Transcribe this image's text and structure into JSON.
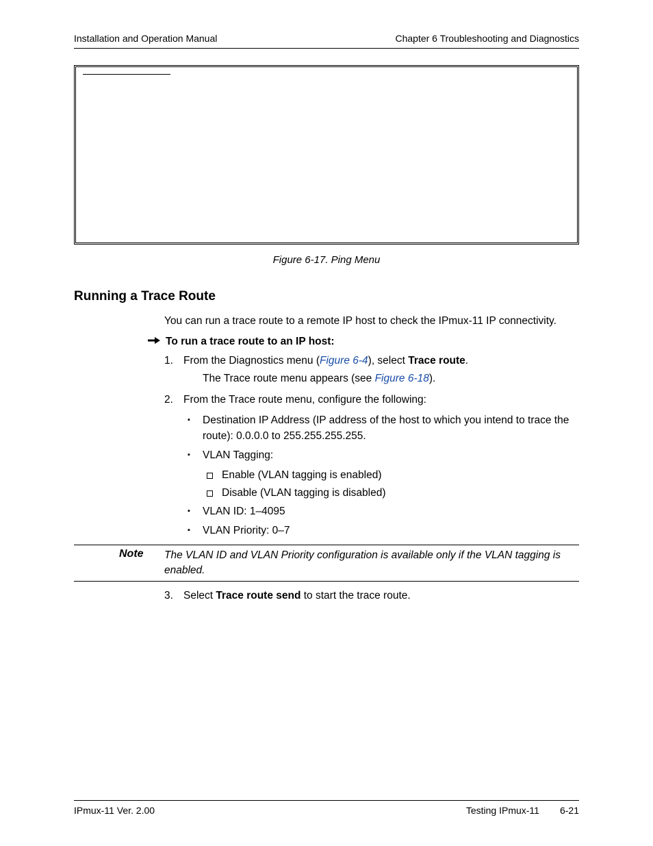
{
  "header": {
    "left": "Installation and Operation Manual",
    "right": "Chapter 6  Troubleshooting and Diagnostics"
  },
  "figcaption": "Figure 6-17.  Ping Menu",
  "section_heading": "Running a Trace Route",
  "intro": "You can run a trace route to a remote IP host to check the IPmux-11 IP connectivity.",
  "proc_heading": "To run a trace route to an IP host:",
  "step1_a": "From the Diagnostics menu (",
  "step1_link": "Figure 6-4",
  "step1_b": "), select ",
  "step1_bold": "Trace route",
  "step1_c": ".",
  "step1_sub_a": "The Trace route menu appears (see ",
  "step1_sub_link": "Figure 6-18",
  "step1_sub_b": ").",
  "step2": "From the Trace route menu, configure the following:",
  "bullet1": "Destination IP Address (IP address of the host to which you intend to trace the route): 0.0.0.0 to 255.255.255.255.",
  "bullet2": "VLAN Tagging:",
  "sq1": "Enable (VLAN tagging is enabled)",
  "sq2": "Disable (VLAN tagging is disabled)",
  "bullet3": "VLAN ID: 1–4095",
  "bullet4": "VLAN Priority: 0–7",
  "note_label": "Note",
  "note_text": "The VLAN ID and VLAN Priority configuration is available only if the VLAN tagging is enabled.",
  "step3_a": "Select ",
  "step3_bold": "Trace route send",
  "step3_b": " to start the trace route.",
  "footer": {
    "left": "IPmux-11 Ver. 2.00",
    "right_title": "Testing IPmux-11",
    "right_page": "6-21"
  }
}
